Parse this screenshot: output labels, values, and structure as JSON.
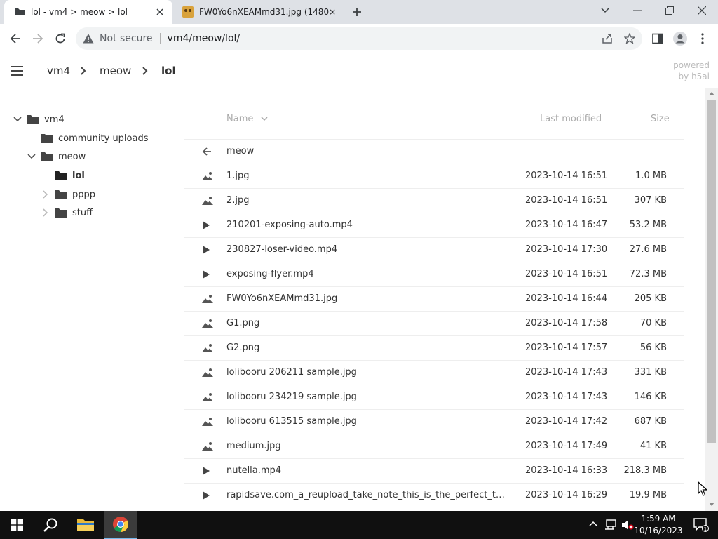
{
  "browser": {
    "tabs": [
      {
        "title": "lol - vm4 > meow > lol",
        "active": true
      },
      {
        "title": "FW0Yo6nXEAMmd31.jpg (1480×",
        "active": false
      }
    ],
    "security_label": "Not secure",
    "url": "vm4/meow/lol/"
  },
  "header": {
    "breadcrumbs": [
      "vm4",
      "meow",
      "lol"
    ],
    "powered_by": [
      "powered",
      "by h5ai"
    ]
  },
  "tree": [
    {
      "label": "vm4",
      "expanded": true,
      "current": false
    },
    {
      "label": "community uploads",
      "expanded": null,
      "current": false
    },
    {
      "label": "meow",
      "expanded": true,
      "current": false
    },
    {
      "label": "lol",
      "expanded": null,
      "current": true
    },
    {
      "label": "pppp",
      "expanded": false,
      "current": false
    },
    {
      "label": "stuff",
      "expanded": false,
      "current": false
    }
  ],
  "columns": {
    "name": "Name",
    "modified": "Last modified",
    "size": "Size"
  },
  "parent": {
    "label": "meow"
  },
  "files": [
    {
      "name": "1.jpg",
      "modified": "2023-10-14 16:51",
      "size": "1.0 MB",
      "type": "image"
    },
    {
      "name": "2.jpg",
      "modified": "2023-10-14 16:51",
      "size": "307 KB",
      "type": "image"
    },
    {
      "name": "210201-exposing-auto.mp4",
      "modified": "2023-10-14 16:47",
      "size": "53.2 MB",
      "type": "video"
    },
    {
      "name": "230827-loser-video.mp4",
      "modified": "2023-10-14 17:30",
      "size": "27.6 MB",
      "type": "video"
    },
    {
      "name": "exposing-flyer.mp4",
      "modified": "2023-10-14 16:51",
      "size": "72.3 MB",
      "type": "video"
    },
    {
      "name": "FW0Yo6nXEAMmd31.jpg",
      "modified": "2023-10-14 16:44",
      "size": "205 KB",
      "type": "image"
    },
    {
      "name": "G1.png",
      "modified": "2023-10-14 17:58",
      "size": "70 KB",
      "type": "image"
    },
    {
      "name": "G2.png",
      "modified": "2023-10-14 17:57",
      "size": "56 KB",
      "type": "image"
    },
    {
      "name": "lolibooru 206211 sample.jpg",
      "modified": "2023-10-14 17:43",
      "size": "331 KB",
      "type": "image"
    },
    {
      "name": "lolibooru 234219 sample.jpg",
      "modified": "2023-10-14 17:43",
      "size": "146 KB",
      "type": "image"
    },
    {
      "name": "lolibooru 613515 sample.jpg",
      "modified": "2023-10-14 17:42",
      "size": "687 KB",
      "type": "image"
    },
    {
      "name": "medium.jpg",
      "modified": "2023-10-14 17:49",
      "size": "41 KB",
      "type": "image"
    },
    {
      "name": "nutella.mp4",
      "modified": "2023-10-14 16:33",
      "size": "218.3 MB",
      "type": "video"
    },
    {
      "name": "rapidsave.com_a_reupload_take_note_this_is_the_perfect_type_...",
      "modified": "2023-10-14 16:29",
      "size": "19.9 MB",
      "type": "video"
    }
  ],
  "taskbar": {
    "time": "1:59 AM",
    "date": "10/16/2023",
    "notification_count": "1"
  }
}
